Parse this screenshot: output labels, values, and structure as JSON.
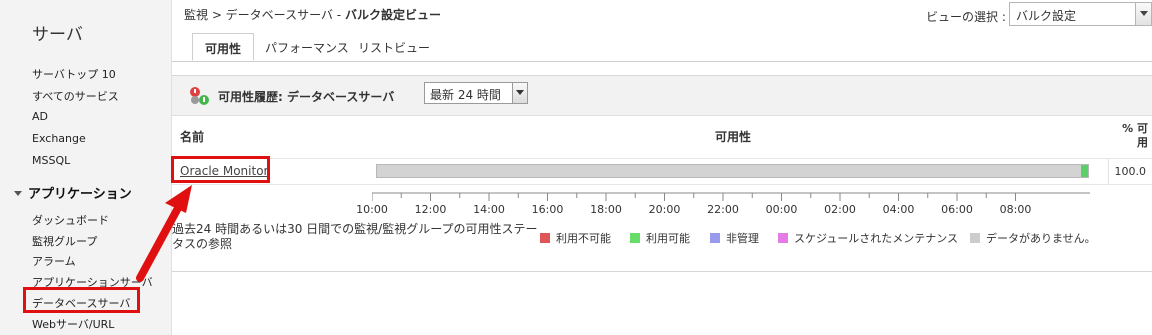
{
  "sidebar": {
    "title": "サーバ",
    "items": [
      "サーバトップ 10",
      "すべてのサービス",
      "AD",
      "Exchange",
      "MSSQL"
    ],
    "section": "アプリケーション",
    "section_items": [
      "ダッシュボード",
      "監視グループ",
      "アラーム",
      "アプリケーションサーバ",
      "データベースサーバ",
      "Webサーバ/URL"
    ]
  },
  "header": {
    "breadcrumb_prefix": "監視 > データベースサーバ - ",
    "breadcrumb_bold": "バルク設定ビュー",
    "view_label": "ビューの選択 :",
    "view_value": "バルク設定"
  },
  "tabs": [
    "可用性",
    "パフォーマンス",
    "リストビュー"
  ],
  "panel": {
    "title": "可用性履歴: データベースサーバ",
    "range_value": "最新 24 時間",
    "col_name": "名前",
    "col_avail": "可用性",
    "col_pct": "% 可用",
    "rows": [
      {
        "name": "Oracle Monitor",
        "availability": 100.0,
        "pct_text": "100.0"
      }
    ]
  },
  "timeline": {
    "labels": [
      "10:00",
      "12:00",
      "14:00",
      "16:00",
      "18:00",
      "20:00",
      "22:00",
      "00:00",
      "02:00",
      "04:00",
      "06:00",
      "08:00"
    ]
  },
  "footnote": "過去24 時間あるいは30 日間での監視/監視グループの可用性ステータスの参照",
  "legend": [
    {
      "label": "利用不可能",
      "color": "#e05555"
    },
    {
      "label": "利用可能",
      "color": "#66dd66"
    },
    {
      "label": "非管理",
      "color": "#9999ee"
    },
    {
      "label": "スケジュールされたメンテナンス",
      "color": "#e57be5"
    },
    {
      "label": "データがありません。",
      "color": "#cccccc"
    }
  ],
  "colors": {
    "annotation_red": "#e01010",
    "available_green": "#5ad06a",
    "bar_gray": "#d3d3d3"
  }
}
